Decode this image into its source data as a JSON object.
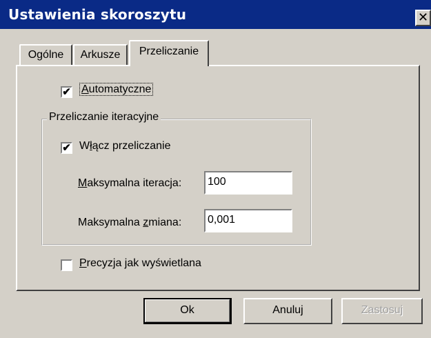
{
  "window": {
    "title": "Ustawienia skoroszytu",
    "close_symbol": "✕"
  },
  "tabs": [
    {
      "label": "Ogólne"
    },
    {
      "label": "Arkusze"
    },
    {
      "label": "Przeliczanie"
    }
  ],
  "automatic": {
    "label_ul": "A",
    "label_rest": "utomatyczne",
    "checked": true,
    "mark": "✔"
  },
  "iteration_group": {
    "title": "Przeliczanie iteracyjne",
    "enable": {
      "label_pre": "W",
      "label_ul": "ł",
      "label_rest": "ącz przeliczanie",
      "checked": true,
      "mark": "✔"
    },
    "max_iter": {
      "label_ul": "M",
      "label_rest": "aksymalna iteracja:",
      "value": "100"
    },
    "max_change": {
      "label_pre": "Maksymalna ",
      "label_ul": "z",
      "label_rest": "miana:",
      "value": "0,001"
    }
  },
  "precision": {
    "label_ul": "P",
    "label_rest": "recyzja jak wyświetlana",
    "checked": false
  },
  "buttons": {
    "ok": "Ok",
    "cancel": "Anuluj",
    "apply": "Zastosuj"
  }
}
